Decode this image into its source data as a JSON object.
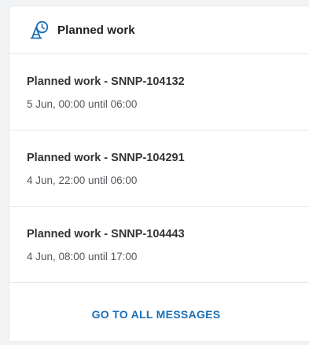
{
  "header": {
    "title": "Planned work",
    "icon": "planned-work-clock-icon",
    "accent_color": "#1a6fb5"
  },
  "items": [
    {
      "title": "Planned work - SNNP-104132",
      "time": "5 Jun, 00:00 until 06:00"
    },
    {
      "title": "Planned work - SNNP-104291",
      "time": "4 Jun, 22:00 until 06:00"
    },
    {
      "title": "Planned work - SNNP-104443",
      "time": "4 Jun, 08:00 until 17:00"
    }
  ],
  "footer": {
    "link_label": "GO TO ALL MESSAGES",
    "link_color": "#1a6fb5"
  }
}
